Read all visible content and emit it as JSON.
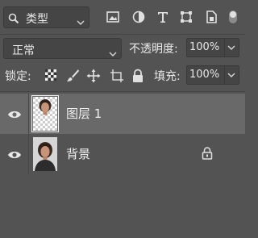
{
  "filter": {
    "kind_label": "类型"
  },
  "blend": {
    "mode": "正常"
  },
  "opacity": {
    "label": "不透明度:",
    "value": "100%"
  },
  "lock": {
    "label": "锁定:"
  },
  "fill": {
    "label": "填充:",
    "value": "100%"
  },
  "layers": [
    {
      "name": "图层 1",
      "selected": true
    },
    {
      "name": "背景",
      "locked": true
    }
  ],
  "colors": {
    "panel": "#535353",
    "selected_row": "#696969",
    "field": "#454545",
    "text": "#e8e8e8"
  }
}
